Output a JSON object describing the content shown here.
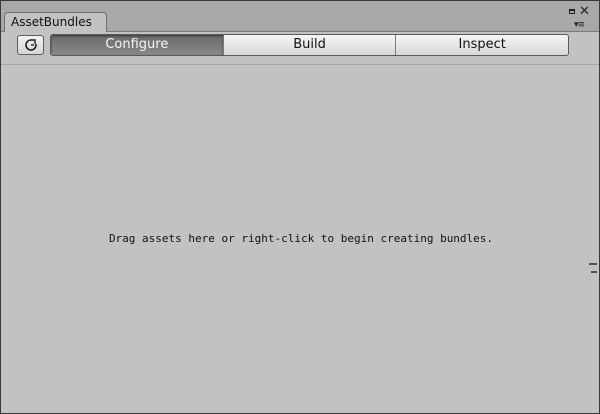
{
  "window": {
    "tab_title": "AssetBundles",
    "controls": {
      "maximize_icon": "maximize-icon",
      "close_glyph": "✕",
      "menu_glyph": "▾≡"
    }
  },
  "toolbar": {
    "refresh_icon": "refresh-icon",
    "tabs": [
      {
        "label": "Configure",
        "active": true
      },
      {
        "label": "Build",
        "active": false
      },
      {
        "label": "Inspect",
        "active": false
      }
    ]
  },
  "content": {
    "hint_text": "Drag assets here or right-click to begin creating bundles."
  },
  "colors": {
    "panel_bg": "#c2c2c2",
    "active_tab": "#6a6a6a"
  }
}
